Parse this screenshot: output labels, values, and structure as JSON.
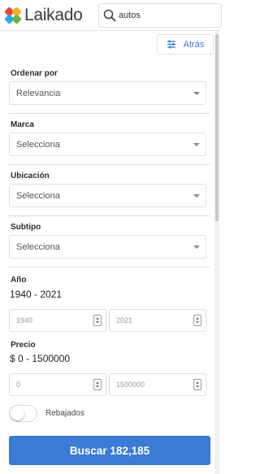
{
  "header": {
    "brand": "Laikado",
    "brand_colors": [
      "#e8442f",
      "#f6b21d",
      "#27a9e1",
      "#6ab344"
    ],
    "search": {
      "value": "autos",
      "icon": "search-icon"
    }
  },
  "filters_panel": {
    "back_button": {
      "label": "Atrás",
      "icon": "sliders-icon",
      "color": "#3a7bd5"
    },
    "sections": {
      "sort": {
        "label": "Ordenar por",
        "value": "Relevancia"
      },
      "brand": {
        "label": "Marca",
        "value": "Selecciona"
      },
      "location": {
        "label": "Ubicación",
        "value": "Selecciona"
      },
      "subtype": {
        "label": "Subtipo",
        "value": "Selecciona"
      }
    },
    "year": {
      "label": "Año",
      "range_text": "1940 - 2021",
      "min_placeholder": "1940",
      "max_placeholder": "2021"
    },
    "price": {
      "label": "Precio",
      "range_text": "$ 0 - 1500000",
      "min_placeholder": "0",
      "max_placeholder": "1500000"
    },
    "discounted": {
      "label": "Rebajados",
      "enabled": false
    },
    "submit": {
      "label": "Buscar 182,185",
      "color": "#3a7bd5"
    }
  }
}
